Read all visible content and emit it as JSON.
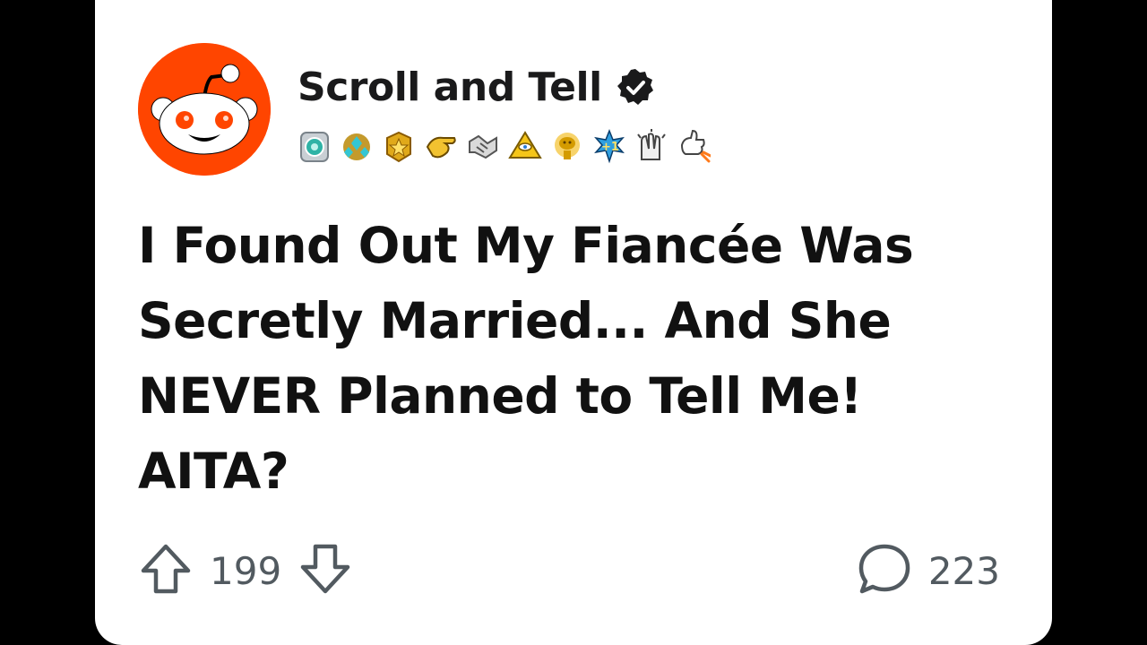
{
  "post": {
    "author_name": "Scroll and Tell",
    "verified": true,
    "title": "I Found Out My Fiancée Was Secretly Married... And She NEVER Planned to Tell Me! AITA?",
    "awards": [
      "silver-medal-award",
      "gem-cluster-award",
      "gold-star-award",
      "pointing-hand-award",
      "handshake-award",
      "illuminati-pyramid-award",
      "gold-snoo-trophy-award",
      "plus-one-award",
      "clapping-hands-award",
      "rocket-like-award"
    ]
  },
  "actions": {
    "upvote_count": "199",
    "comment_count": "223"
  },
  "colors": {
    "brand": "#ff4500",
    "text": "#111111",
    "muted": "#525a60",
    "background": "#000000",
    "card": "#ffffff"
  }
}
